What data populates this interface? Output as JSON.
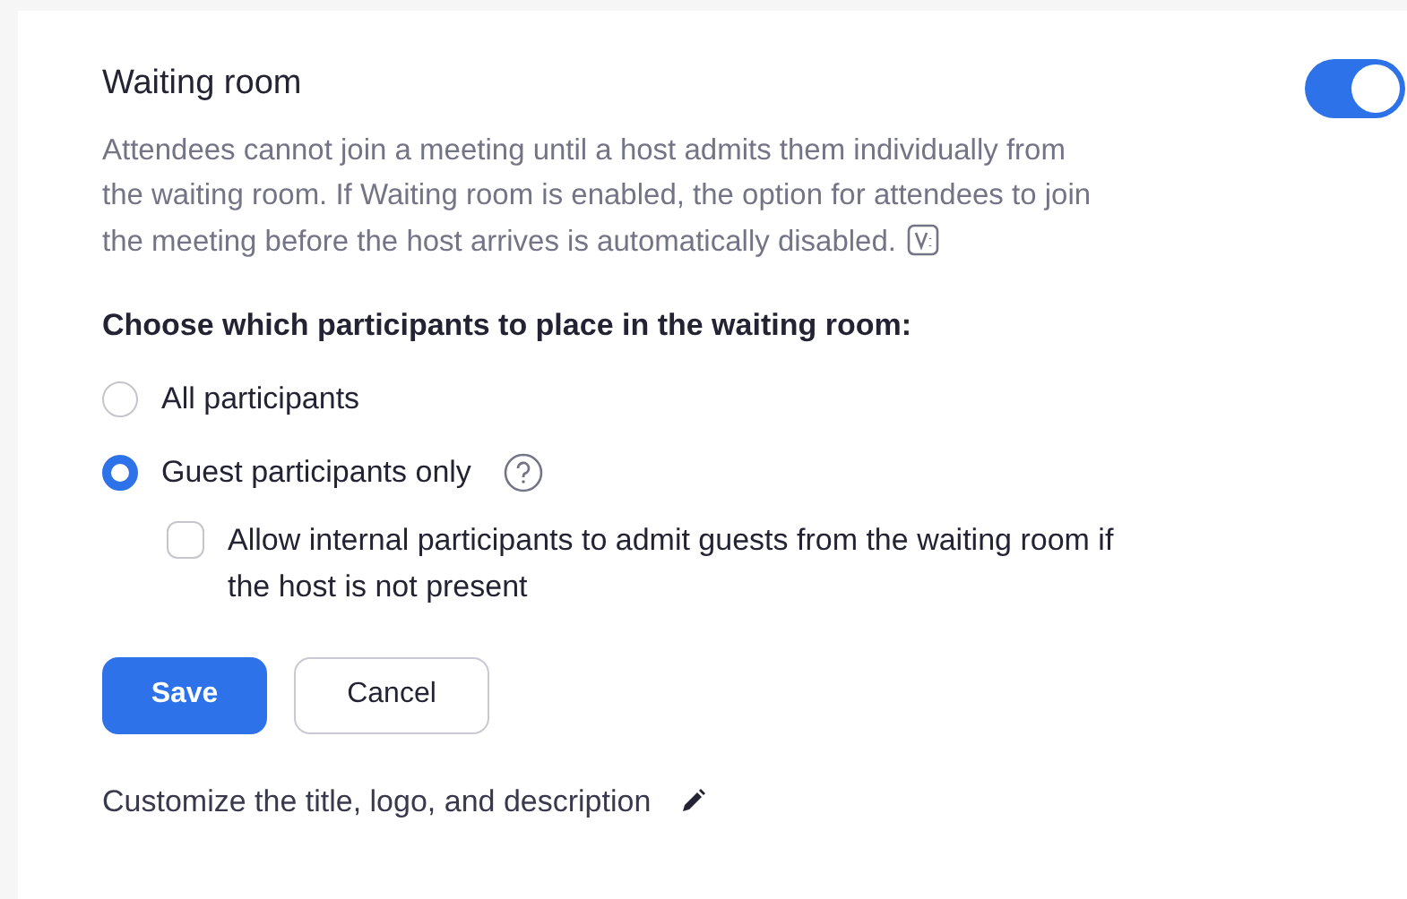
{
  "setting": {
    "title": "Waiting room",
    "description": "Attendees cannot join a meeting until a host admits them individually from the waiting room. If Waiting room is enabled, the option for attendees to join the meeting before the host arrives is automatically disabled.",
    "enabled": true
  },
  "options_heading": "Choose which participants to place in the waiting room:",
  "options": [
    {
      "label": "All participants",
      "selected": false,
      "has_help": false
    },
    {
      "label": "Guest participants only",
      "selected": true,
      "has_help": true
    }
  ],
  "sub_option": {
    "label": "Allow internal participants to admit guests from the waiting room if the host is not present",
    "checked": false
  },
  "buttons": [
    {
      "label": "Save",
      "kind": "primary"
    },
    {
      "label": "Cancel",
      "kind": "secondary"
    }
  ],
  "customize": {
    "label": "Customize the title, logo, and description"
  }
}
